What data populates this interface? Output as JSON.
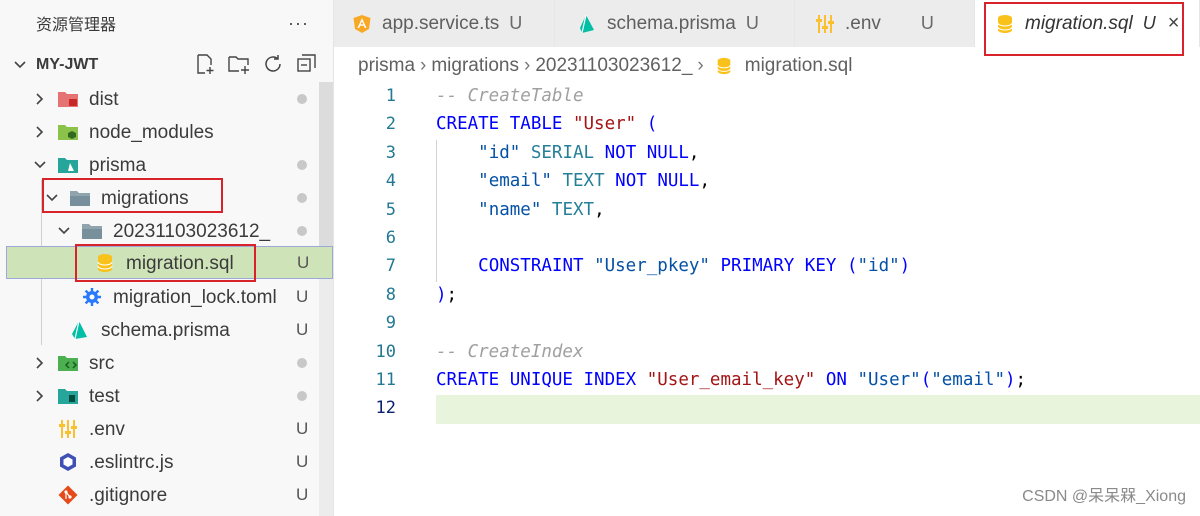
{
  "sidebar": {
    "title": "资源管理器",
    "more": "···",
    "project": "MY-JWT",
    "actions": [
      "new-file-icon",
      "new-folder-icon",
      "refresh-icon",
      "collapse-all-icon"
    ],
    "items": [
      {
        "label": "dist",
        "status": "dot",
        "expanded": false,
        "icon": "folder-dist-icon"
      },
      {
        "label": "node_modules",
        "status": "",
        "expanded": false,
        "icon": "folder-node-icon"
      },
      {
        "label": "prisma",
        "status": "dot",
        "expanded": true,
        "icon": "folder-prisma-icon"
      },
      {
        "label": "migrations",
        "status": "dot",
        "expanded": true,
        "icon": "folder-icon"
      },
      {
        "label": "20231103023612_",
        "status": "dot",
        "expanded": true,
        "icon": "folder-icon"
      },
      {
        "label": "migration.sql",
        "status": "U",
        "icon": "database-icon"
      },
      {
        "label": "migration_lock.toml",
        "status": "U",
        "icon": "gear-icon"
      },
      {
        "label": "schema.prisma",
        "status": "U",
        "icon": "prisma-icon"
      },
      {
        "label": "src",
        "status": "dot",
        "expanded": false,
        "icon": "folder-src-icon"
      },
      {
        "label": "test",
        "status": "dot",
        "expanded": false,
        "icon": "folder-test-icon"
      },
      {
        "label": ".env",
        "status": "U",
        "icon": "settings-sliders-icon"
      },
      {
        "label": ".eslintrc.js",
        "status": "U",
        "icon": "eslint-icon"
      },
      {
        "label": ".gitignore",
        "status": "U",
        "icon": "git-icon"
      }
    ]
  },
  "tabs": [
    {
      "label": "app.service.ts",
      "status": "U",
      "icon": "angular-icon"
    },
    {
      "label": "schema.prisma",
      "status": "U",
      "icon": "prisma-icon"
    },
    {
      "label": ".env",
      "status": "U",
      "icon": "settings-sliders-icon"
    },
    {
      "label": "migration.sql",
      "status": "U",
      "icon": "database-icon",
      "active": true,
      "close": "×"
    }
  ],
  "breadcrumb": {
    "parts": [
      "prisma",
      "migrations",
      "20231103023612_",
      "migration.sql"
    ],
    "sep": "›"
  },
  "editor": {
    "active_line": 12,
    "lines": [
      {
        "n": "1",
        "tokens": [
          [
            "cmt",
            "-- CreateTable"
          ]
        ]
      },
      {
        "n": "2",
        "tokens": [
          [
            "kw",
            "CREATE TABLE "
          ],
          [
            "str",
            "\"User\""
          ],
          [
            "plain",
            " "
          ],
          [
            "kw",
            "("
          ]
        ]
      },
      {
        "n": "3",
        "tokens": [
          [
            "plain",
            "    "
          ],
          [
            "str2",
            "\"id\""
          ],
          [
            "plain",
            " "
          ],
          [
            "type",
            "SERIAL"
          ],
          [
            "plain",
            " "
          ],
          [
            "kw",
            "NOT NULL"
          ],
          [
            "plain",
            ","
          ]
        ]
      },
      {
        "n": "4",
        "tokens": [
          [
            "plain",
            "    "
          ],
          [
            "str2",
            "\"email\""
          ],
          [
            "plain",
            " "
          ],
          [
            "type",
            "TEXT"
          ],
          [
            "plain",
            " "
          ],
          [
            "kw",
            "NOT NULL"
          ],
          [
            "plain",
            ","
          ]
        ]
      },
      {
        "n": "5",
        "tokens": [
          [
            "plain",
            "    "
          ],
          [
            "str2",
            "\"name\""
          ],
          [
            "plain",
            " "
          ],
          [
            "type",
            "TEXT"
          ],
          [
            "plain",
            ","
          ]
        ]
      },
      {
        "n": "6",
        "tokens": []
      },
      {
        "n": "7",
        "tokens": [
          [
            "plain",
            "    "
          ],
          [
            "kw",
            "CONSTRAINT"
          ],
          [
            "plain",
            " "
          ],
          [
            "str2",
            "\"User_pkey\""
          ],
          [
            "plain",
            " "
          ],
          [
            "kw",
            "PRIMARY KEY"
          ],
          [
            "plain",
            " "
          ],
          [
            "kw",
            "("
          ],
          [
            "str2",
            "\"id\""
          ],
          [
            "kw",
            ")"
          ]
        ]
      },
      {
        "n": "8",
        "tokens": [
          [
            "kw",
            ")"
          ],
          [
            "plain",
            ";"
          ]
        ]
      },
      {
        "n": "9",
        "tokens": []
      },
      {
        "n": "10",
        "tokens": [
          [
            "cmt",
            "-- CreateIndex"
          ]
        ]
      },
      {
        "n": "11",
        "tokens": [
          [
            "kw",
            "CREATE UNIQUE INDEX "
          ],
          [
            "str",
            "\"User_email_key\""
          ],
          [
            "plain",
            " "
          ],
          [
            "kw",
            "ON"
          ],
          [
            "plain",
            " "
          ],
          [
            "str2",
            "\"User\""
          ],
          [
            "kw",
            "("
          ],
          [
            "str2",
            "\"email\""
          ],
          [
            "kw",
            ")"
          ],
          [
            "plain",
            ";"
          ]
        ]
      },
      {
        "n": "12",
        "tokens": []
      }
    ]
  },
  "watermark": "CSDN @呆呆槑_Xiong",
  "colors": {
    "accent_red_box": "#d9232a",
    "selected_row": "#cfe3b9",
    "current_line": "#e8f5dc",
    "keyword": "#0000ff",
    "string": "#a31515",
    "comment": "#a0a0a0"
  }
}
